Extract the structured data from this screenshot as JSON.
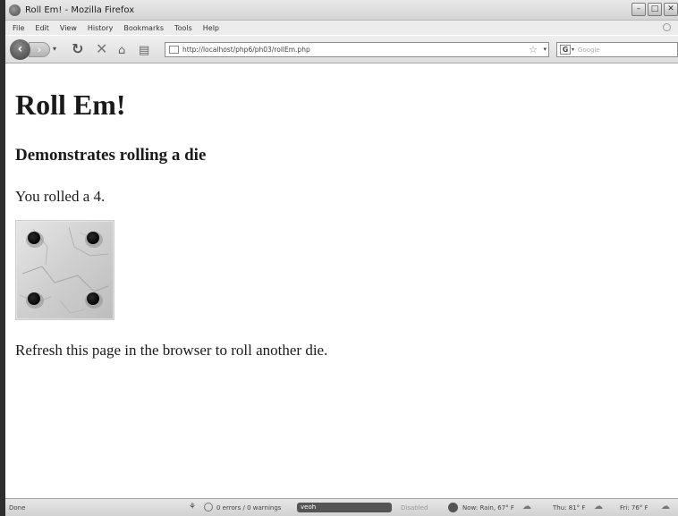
{
  "window": {
    "title": "Roll Em! - Mozilla Firefox"
  },
  "menu": {
    "items": [
      "File",
      "Edit",
      "View",
      "History",
      "Bookmarks",
      "Tools",
      "Help"
    ]
  },
  "navbar": {
    "url": "http://localhost/php6/ph03/rollEm.php",
    "search_placeholder": "Google",
    "search_engine_letter": "G"
  },
  "page": {
    "heading": "Roll Em!",
    "subheading": "Demonstrates rolling a die",
    "result_text": "You rolled a 4.",
    "die_value": 4,
    "refresh_text": "Refresh this page in the browser to roll another die."
  },
  "statusbar": {
    "status": "Done",
    "errors": "0 errors / 0 warnings",
    "disabled": "Disabled",
    "weather_now": "Now: Rain, 67° F",
    "weather_thu": "Thu: 81° F",
    "weather_fri": "Fri: 76° F",
    "badge_label": "veoh"
  },
  "colors": {
    "window_border": "#2e2e2e",
    "page_background": "#ffffff",
    "text": "#1a1a1a"
  }
}
